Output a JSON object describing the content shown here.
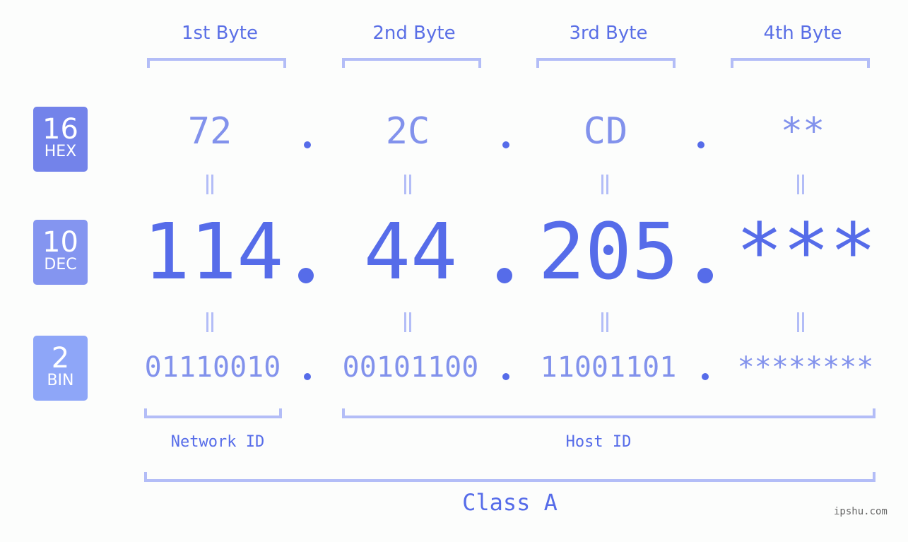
{
  "byte_headers": [
    "1st Byte",
    "2nd Byte",
    "3rd Byte",
    "4th Byte"
  ],
  "rows": {
    "hex": {
      "base": "16",
      "label": "HEX",
      "values": [
        "72",
        "2C",
        "CD",
        "**"
      ],
      "color": "#7383ea"
    },
    "dec": {
      "base": "10",
      "label": "DEC",
      "values": [
        "114",
        "44",
        "205",
        "***"
      ],
      "color": "#8495f0"
    },
    "bin": {
      "base": "2",
      "label": "BIN",
      "values": [
        "01110010",
        "00101100",
        "11001101",
        "********"
      ],
      "color": "#8ea6f8"
    }
  },
  "labels": {
    "network_id": "Network ID",
    "host_id": "Host ID",
    "class": "Class A"
  },
  "watermark": "ipshu.com",
  "colors": {
    "primary": "#566ce9",
    "light": "#8292ec",
    "bracket": "#b3bdf7"
  }
}
